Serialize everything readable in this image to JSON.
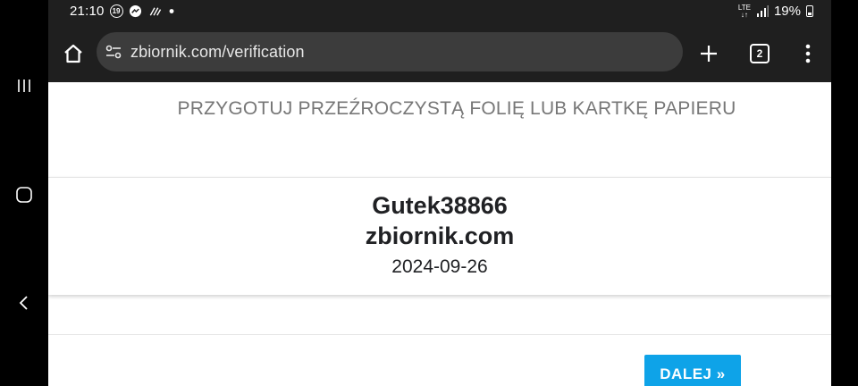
{
  "status_bar": {
    "time": "21:10",
    "notification_badge": "19",
    "network": "LTE",
    "battery": "19%"
  },
  "browser": {
    "url": "zbiornik.com/verification",
    "tab_count": "2"
  },
  "page": {
    "instruction": "PRZYGOTUJ PRZEŹROCZYSTĄ FOLIĘ LUB KARTKĘ PAPIERU",
    "card": {
      "username": "Gutek38866",
      "site": "zbiornik.com",
      "date": "2024-09-26"
    },
    "next_label": "DALEJ »"
  },
  "colors": {
    "accent": "#0ea3e8",
    "toolbar_bg": "#1f1f1f",
    "urlbar_bg": "#3c3c3c",
    "instruction_text": "#777777"
  },
  "icons": {
    "nav": [
      "recents-icon",
      "home-circle-icon",
      "back-icon"
    ],
    "status": [
      "badge-19-icon",
      "messenger-icon",
      "wifi-calling-icon",
      "dot-icon",
      "lte-icon",
      "signal-icon",
      "battery-icon"
    ],
    "toolbar": [
      "home-icon",
      "tune-icon",
      "plus-icon",
      "tabs-icon",
      "more-vert-icon"
    ]
  }
}
